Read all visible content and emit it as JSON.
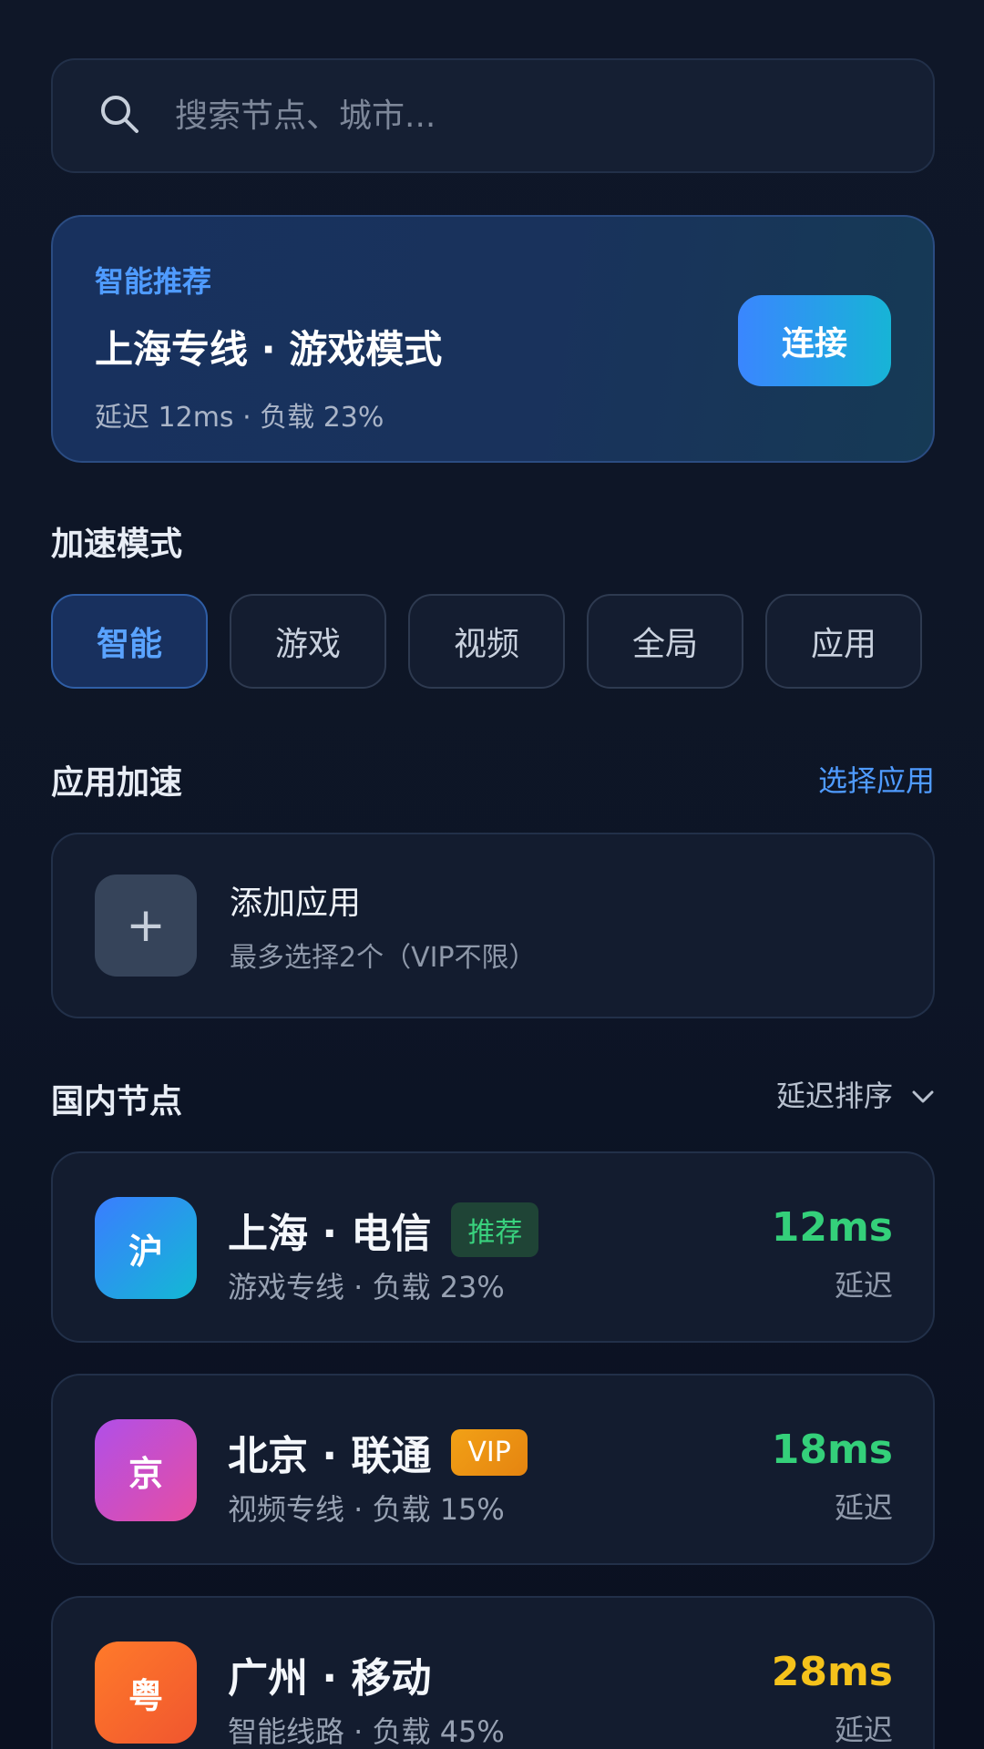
{
  "search": {
    "placeholder": "搜索节点、城市..."
  },
  "recommend": {
    "eyebrow": "智能推荐",
    "title": "上海专线 · 游戏模式",
    "meta": "延迟 12ms · 负载 23%",
    "connect_label": "连接"
  },
  "modes": {
    "title": "加速模式",
    "items": [
      "智能",
      "游戏",
      "视频",
      "全局",
      "应用"
    ],
    "active": "智能"
  },
  "apps": {
    "title": "应用加速",
    "link": "选择应用",
    "add_title": "添加应用",
    "add_sub": "最多选择2个（VIP不限）",
    "plus": "+"
  },
  "domestic": {
    "title": "国内节点",
    "sort_label": "延迟排序",
    "nodes": [
      {
        "abbr": "沪",
        "name": "上海 · 电信",
        "tag": "推荐",
        "desc": "游戏专线 · 负载 23%",
        "latency": "12ms",
        "latency_label": "延迟"
      },
      {
        "abbr": "京",
        "name": "北京 · 联通",
        "tag": "VIP",
        "desc": "视频专线 · 负载 15%",
        "latency": "18ms",
        "latency_label": "延迟"
      },
      {
        "abbr": "粤",
        "name": "广州 · 移动",
        "tag": "",
        "desc": "智能线路 · 负载 45%",
        "latency": "28ms",
        "latency_label": "延迟"
      }
    ]
  },
  "colors": {
    "accent": "#4f9bff",
    "good_latency": "#34d07a",
    "warn_latency": "#f5c21b",
    "tag_recommend_bg": "#1f4436",
    "tag_vip_bg": "#f29a12"
  }
}
